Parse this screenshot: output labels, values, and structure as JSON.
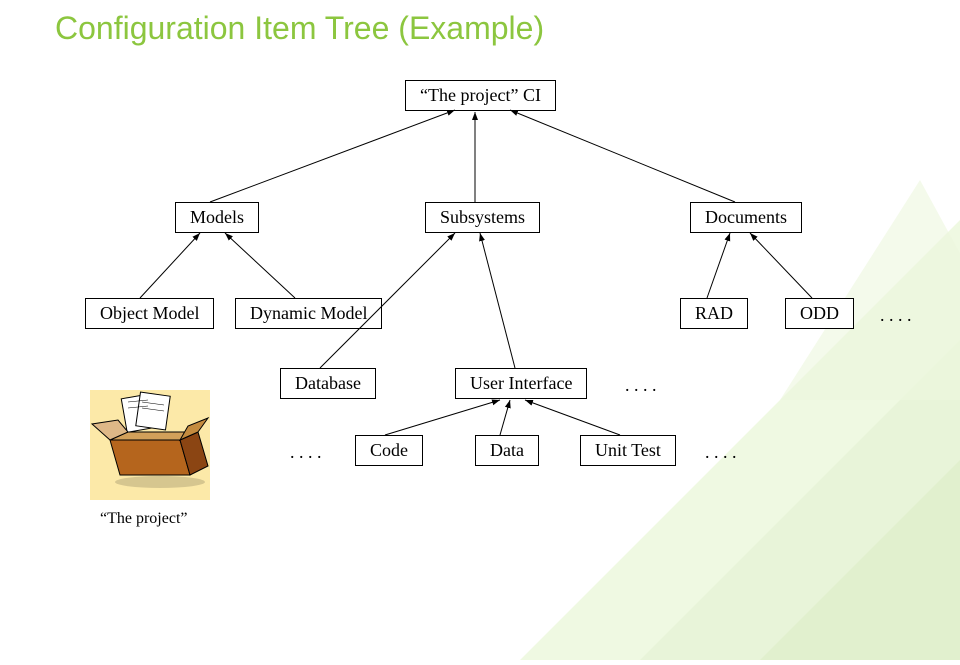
{
  "title": "Configuration Item Tree (Example)",
  "root": "“The project” CI",
  "level1": {
    "models": "Models",
    "subsystems": "Subsystems",
    "documents": "Documents"
  },
  "models_children": {
    "object_model": "Object Model",
    "dynamic_model": "Dynamic Model"
  },
  "documents_children": {
    "rad": "RAD",
    "odd": "ODD",
    "more": ". . . ."
  },
  "subsystems_children": {
    "database": "Database",
    "user_interface": "User Interface",
    "more": ". . . ."
  },
  "database_children": {
    "pre": ". . . .",
    "code": "Code",
    "data": "Data",
    "unit_test": "Unit Test",
    "post": ". . . ."
  },
  "box_caption": "“The project”"
}
